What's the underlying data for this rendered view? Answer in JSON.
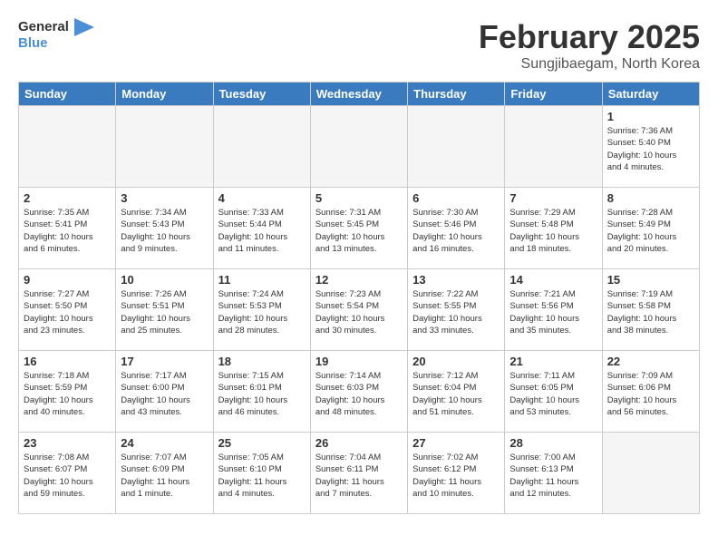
{
  "logo": {
    "line1": "General",
    "line2": "Blue"
  },
  "title": "February 2025",
  "subtitle": "Sungjibaegam, North Korea",
  "days_of_week": [
    "Sunday",
    "Monday",
    "Tuesday",
    "Wednesday",
    "Thursday",
    "Friday",
    "Saturday"
  ],
  "weeks": [
    [
      {
        "num": "",
        "info": ""
      },
      {
        "num": "",
        "info": ""
      },
      {
        "num": "",
        "info": ""
      },
      {
        "num": "",
        "info": ""
      },
      {
        "num": "",
        "info": ""
      },
      {
        "num": "",
        "info": ""
      },
      {
        "num": "1",
        "info": "Sunrise: 7:36 AM\nSunset: 5:40 PM\nDaylight: 10 hours\nand 4 minutes."
      }
    ],
    [
      {
        "num": "2",
        "info": "Sunrise: 7:35 AM\nSunset: 5:41 PM\nDaylight: 10 hours\nand 6 minutes."
      },
      {
        "num": "3",
        "info": "Sunrise: 7:34 AM\nSunset: 5:43 PM\nDaylight: 10 hours\nand 9 minutes."
      },
      {
        "num": "4",
        "info": "Sunrise: 7:33 AM\nSunset: 5:44 PM\nDaylight: 10 hours\nand 11 minutes."
      },
      {
        "num": "5",
        "info": "Sunrise: 7:31 AM\nSunset: 5:45 PM\nDaylight: 10 hours\nand 13 minutes."
      },
      {
        "num": "6",
        "info": "Sunrise: 7:30 AM\nSunset: 5:46 PM\nDaylight: 10 hours\nand 16 minutes."
      },
      {
        "num": "7",
        "info": "Sunrise: 7:29 AM\nSunset: 5:48 PM\nDaylight: 10 hours\nand 18 minutes."
      },
      {
        "num": "8",
        "info": "Sunrise: 7:28 AM\nSunset: 5:49 PM\nDaylight: 10 hours\nand 20 minutes."
      }
    ],
    [
      {
        "num": "9",
        "info": "Sunrise: 7:27 AM\nSunset: 5:50 PM\nDaylight: 10 hours\nand 23 minutes."
      },
      {
        "num": "10",
        "info": "Sunrise: 7:26 AM\nSunset: 5:51 PM\nDaylight: 10 hours\nand 25 minutes."
      },
      {
        "num": "11",
        "info": "Sunrise: 7:24 AM\nSunset: 5:53 PM\nDaylight: 10 hours\nand 28 minutes."
      },
      {
        "num": "12",
        "info": "Sunrise: 7:23 AM\nSunset: 5:54 PM\nDaylight: 10 hours\nand 30 minutes."
      },
      {
        "num": "13",
        "info": "Sunrise: 7:22 AM\nSunset: 5:55 PM\nDaylight: 10 hours\nand 33 minutes."
      },
      {
        "num": "14",
        "info": "Sunrise: 7:21 AM\nSunset: 5:56 PM\nDaylight: 10 hours\nand 35 minutes."
      },
      {
        "num": "15",
        "info": "Sunrise: 7:19 AM\nSunset: 5:58 PM\nDaylight: 10 hours\nand 38 minutes."
      }
    ],
    [
      {
        "num": "16",
        "info": "Sunrise: 7:18 AM\nSunset: 5:59 PM\nDaylight: 10 hours\nand 40 minutes."
      },
      {
        "num": "17",
        "info": "Sunrise: 7:17 AM\nSunset: 6:00 PM\nDaylight: 10 hours\nand 43 minutes."
      },
      {
        "num": "18",
        "info": "Sunrise: 7:15 AM\nSunset: 6:01 PM\nDaylight: 10 hours\nand 46 minutes."
      },
      {
        "num": "19",
        "info": "Sunrise: 7:14 AM\nSunset: 6:03 PM\nDaylight: 10 hours\nand 48 minutes."
      },
      {
        "num": "20",
        "info": "Sunrise: 7:12 AM\nSunset: 6:04 PM\nDaylight: 10 hours\nand 51 minutes."
      },
      {
        "num": "21",
        "info": "Sunrise: 7:11 AM\nSunset: 6:05 PM\nDaylight: 10 hours\nand 53 minutes."
      },
      {
        "num": "22",
        "info": "Sunrise: 7:09 AM\nSunset: 6:06 PM\nDaylight: 10 hours\nand 56 minutes."
      }
    ],
    [
      {
        "num": "23",
        "info": "Sunrise: 7:08 AM\nSunset: 6:07 PM\nDaylight: 10 hours\nand 59 minutes."
      },
      {
        "num": "24",
        "info": "Sunrise: 7:07 AM\nSunset: 6:09 PM\nDaylight: 11 hours\nand 1 minute."
      },
      {
        "num": "25",
        "info": "Sunrise: 7:05 AM\nSunset: 6:10 PM\nDaylight: 11 hours\nand 4 minutes."
      },
      {
        "num": "26",
        "info": "Sunrise: 7:04 AM\nSunset: 6:11 PM\nDaylight: 11 hours\nand 7 minutes."
      },
      {
        "num": "27",
        "info": "Sunrise: 7:02 AM\nSunset: 6:12 PM\nDaylight: 11 hours\nand 10 minutes."
      },
      {
        "num": "28",
        "info": "Sunrise: 7:00 AM\nSunset: 6:13 PM\nDaylight: 11 hours\nand 12 minutes."
      },
      {
        "num": "",
        "info": ""
      }
    ]
  ]
}
